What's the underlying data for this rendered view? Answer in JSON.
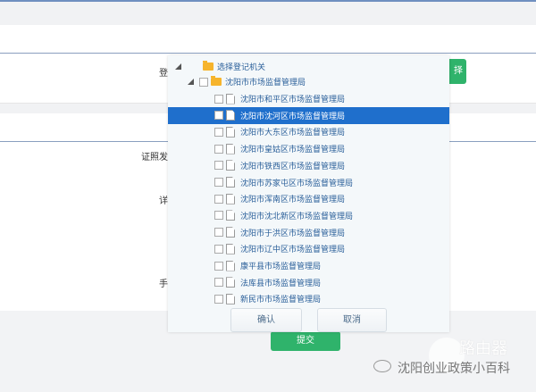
{
  "form": {
    "label_registration": "登",
    "select_button": "择",
    "label_issuer": "证照发",
    "label_detail": "详",
    "label_blank": "",
    "label_phone": "手",
    "submit": "提交"
  },
  "tree": {
    "root": "选择登记机关",
    "parent": "沈阳市市场监督管理局",
    "items": [
      {
        "label": "沈阳市和平区市场监督管理局",
        "selected": false
      },
      {
        "label": "沈阳市沈河区市场监督管理局",
        "selected": true
      },
      {
        "label": "沈阳市大东区市场监督管理局",
        "selected": false
      },
      {
        "label": "沈阳市皇姑区市场监督管理局",
        "selected": false
      },
      {
        "label": "沈阳市铁西区市场监督管理局",
        "selected": false
      },
      {
        "label": "沈阳市苏家屯区市场监督管理局",
        "selected": false
      },
      {
        "label": "沈阳市浑南区市场监督管理局",
        "selected": false
      },
      {
        "label": "沈阳市沈北新区市场监督管理局",
        "selected": false
      },
      {
        "label": "沈阳市于洪区市场监督管理局",
        "selected": false
      },
      {
        "label": "沈阳市辽中区市场监督管理局",
        "selected": false
      },
      {
        "label": "康平县市场监督管理局",
        "selected": false
      },
      {
        "label": "法库县市场监督管理局",
        "selected": false
      },
      {
        "label": "新民市市场监督管理局",
        "selected": false
      }
    ],
    "confirm": "确认",
    "cancel": "取消"
  },
  "watermark": {
    "brand": "路由器",
    "account": "沈阳创业政策小百科"
  },
  "colors": {
    "accent": "#1f6fcc",
    "green": "#2fb36b"
  }
}
